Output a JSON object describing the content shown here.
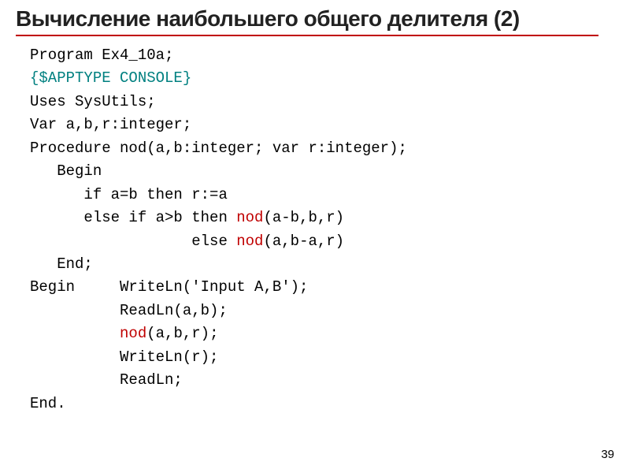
{
  "title": "Вычисление наибольшего общего делителя (2)",
  "code": {
    "l1": "Program Ex4_10a;",
    "l2": "{$APPTYPE CONSOLE}",
    "l3": "Uses SysUtils;",
    "l4": "Var a,b,r:integer;",
    "l5": "Procedure nod(a,b:integer; var r:integer);",
    "l6": "   Begin",
    "l7": "      if a=b then r:=a",
    "l8a": "      else if a>b then ",
    "l8b": "nod",
    "l8c": "(a-b,b,r)",
    "l9a": "                  else ",
    "l9b": "nod",
    "l9c": "(a,b-a,r)",
    "l10": "   End;",
    "l11": "Begin     WriteLn('Input A,B');",
    "l12": "          ReadLn(a,b);",
    "l13a": "          ",
    "l13b": "nod",
    "l13c": "(a,b,r);",
    "l14": "          WriteLn(r);",
    "l15": "          ReadLn;",
    "l16": "End."
  },
  "page_number": "39"
}
